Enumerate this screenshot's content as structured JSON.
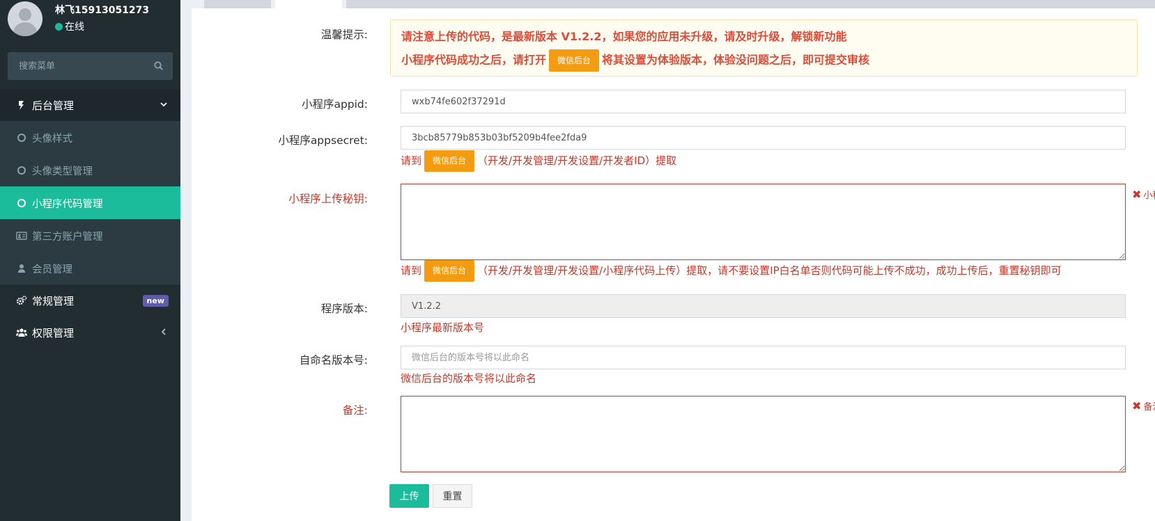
{
  "user": {
    "name": "林飞15913051273",
    "status": "在线"
  },
  "search": {
    "placeholder": "搜索菜单"
  },
  "sidebar": {
    "sections": [
      {
        "label": "后台管理",
        "icon": "dashboard-icon"
      },
      {
        "label": "常规管理",
        "icon": "cogs-icon",
        "badge": "new"
      },
      {
        "label": "权限管理",
        "icon": "group-icon"
      }
    ],
    "items": [
      {
        "label": "头像样式",
        "icon": "circle-icon"
      },
      {
        "label": "头像类型管理",
        "icon": "circle-icon"
      },
      {
        "label": "小程序代码管理",
        "icon": "circle-icon",
        "active": true
      },
      {
        "label": "第三方账户管理",
        "icon": "id-card-icon"
      },
      {
        "label": "会员管理",
        "icon": "user-icon"
      }
    ]
  },
  "form": {
    "notice": {
      "label": "温馨提示:",
      "line1": "请注意上传的代码，是最新版本 V1.2.2，如果您的应用未升级，请及时升级，解锁新功能",
      "line2_before": "小程序代码成功之后，请打开",
      "line2_button": "微信后台",
      "line2_after": "将其设置为体验版本，体验没问题之后，即可提交审核"
    },
    "appid": {
      "label": "小程序appid:",
      "value": "wxb74fe602f37291d"
    },
    "appsecret": {
      "label": "小程序appsecret:",
      "value": "3bcb85779b853b03bf5209b4fee2fda9",
      "help_before": "请到",
      "help_button": "微信后台",
      "help_after": "（开发/开发管理/开发设置/开发者ID）提取"
    },
    "upload_key": {
      "label": "小程序上传秘钥:",
      "help_before": "请到",
      "help_button": "微信后台",
      "help_after": "（开发/开发管理/开发设置/小程序代码上传）提取，请不要设置IP白名单否则代码可能上传不成功，成功上传后，重置秘钥即可",
      "error": "小程序"
    },
    "version": {
      "label": "程序版本:",
      "value": "V1.2.2",
      "help": "小程序最新版本号"
    },
    "custom_version": {
      "label": "自命名版本号:",
      "placeholder": "微信后台的版本号将以此命名",
      "help": "微信后台的版本号将以此命名"
    },
    "remark": {
      "label": "备注:",
      "error": "备注不"
    },
    "buttons": {
      "upload": "上传",
      "reset": "重置"
    }
  },
  "colors": {
    "accent": "#1abc9c",
    "warning": "#f39c12",
    "error": "#c0392b",
    "sidebar": "#222d32",
    "badge": "#605ca8"
  }
}
